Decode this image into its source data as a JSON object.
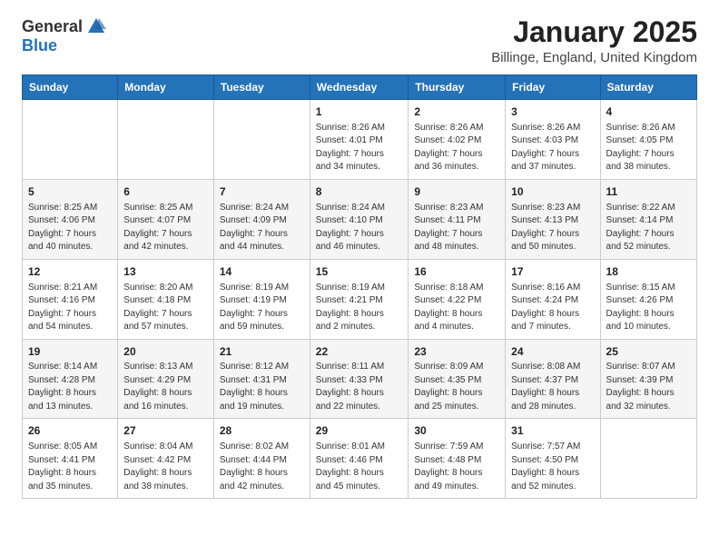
{
  "header": {
    "logo_general": "General",
    "logo_blue": "Blue",
    "month_title": "January 2025",
    "location": "Billinge, England, United Kingdom"
  },
  "weekdays": [
    "Sunday",
    "Monday",
    "Tuesday",
    "Wednesday",
    "Thursday",
    "Friday",
    "Saturday"
  ],
  "weeks": [
    [
      {
        "day": "",
        "info": ""
      },
      {
        "day": "",
        "info": ""
      },
      {
        "day": "",
        "info": ""
      },
      {
        "day": "1",
        "info": "Sunrise: 8:26 AM\nSunset: 4:01 PM\nDaylight: 7 hours\nand 34 minutes."
      },
      {
        "day": "2",
        "info": "Sunrise: 8:26 AM\nSunset: 4:02 PM\nDaylight: 7 hours\nand 36 minutes."
      },
      {
        "day": "3",
        "info": "Sunrise: 8:26 AM\nSunset: 4:03 PM\nDaylight: 7 hours\nand 37 minutes."
      },
      {
        "day": "4",
        "info": "Sunrise: 8:26 AM\nSunset: 4:05 PM\nDaylight: 7 hours\nand 38 minutes."
      }
    ],
    [
      {
        "day": "5",
        "info": "Sunrise: 8:25 AM\nSunset: 4:06 PM\nDaylight: 7 hours\nand 40 minutes."
      },
      {
        "day": "6",
        "info": "Sunrise: 8:25 AM\nSunset: 4:07 PM\nDaylight: 7 hours\nand 42 minutes."
      },
      {
        "day": "7",
        "info": "Sunrise: 8:24 AM\nSunset: 4:09 PM\nDaylight: 7 hours\nand 44 minutes."
      },
      {
        "day": "8",
        "info": "Sunrise: 8:24 AM\nSunset: 4:10 PM\nDaylight: 7 hours\nand 46 minutes."
      },
      {
        "day": "9",
        "info": "Sunrise: 8:23 AM\nSunset: 4:11 PM\nDaylight: 7 hours\nand 48 minutes."
      },
      {
        "day": "10",
        "info": "Sunrise: 8:23 AM\nSunset: 4:13 PM\nDaylight: 7 hours\nand 50 minutes."
      },
      {
        "day": "11",
        "info": "Sunrise: 8:22 AM\nSunset: 4:14 PM\nDaylight: 7 hours\nand 52 minutes."
      }
    ],
    [
      {
        "day": "12",
        "info": "Sunrise: 8:21 AM\nSunset: 4:16 PM\nDaylight: 7 hours\nand 54 minutes."
      },
      {
        "day": "13",
        "info": "Sunrise: 8:20 AM\nSunset: 4:18 PM\nDaylight: 7 hours\nand 57 minutes."
      },
      {
        "day": "14",
        "info": "Sunrise: 8:19 AM\nSunset: 4:19 PM\nDaylight: 7 hours\nand 59 minutes."
      },
      {
        "day": "15",
        "info": "Sunrise: 8:19 AM\nSunset: 4:21 PM\nDaylight: 8 hours\nand 2 minutes."
      },
      {
        "day": "16",
        "info": "Sunrise: 8:18 AM\nSunset: 4:22 PM\nDaylight: 8 hours\nand 4 minutes."
      },
      {
        "day": "17",
        "info": "Sunrise: 8:16 AM\nSunset: 4:24 PM\nDaylight: 8 hours\nand 7 minutes."
      },
      {
        "day": "18",
        "info": "Sunrise: 8:15 AM\nSunset: 4:26 PM\nDaylight: 8 hours\nand 10 minutes."
      }
    ],
    [
      {
        "day": "19",
        "info": "Sunrise: 8:14 AM\nSunset: 4:28 PM\nDaylight: 8 hours\nand 13 minutes."
      },
      {
        "day": "20",
        "info": "Sunrise: 8:13 AM\nSunset: 4:29 PM\nDaylight: 8 hours\nand 16 minutes."
      },
      {
        "day": "21",
        "info": "Sunrise: 8:12 AM\nSunset: 4:31 PM\nDaylight: 8 hours\nand 19 minutes."
      },
      {
        "day": "22",
        "info": "Sunrise: 8:11 AM\nSunset: 4:33 PM\nDaylight: 8 hours\nand 22 minutes."
      },
      {
        "day": "23",
        "info": "Sunrise: 8:09 AM\nSunset: 4:35 PM\nDaylight: 8 hours\nand 25 minutes."
      },
      {
        "day": "24",
        "info": "Sunrise: 8:08 AM\nSunset: 4:37 PM\nDaylight: 8 hours\nand 28 minutes."
      },
      {
        "day": "25",
        "info": "Sunrise: 8:07 AM\nSunset: 4:39 PM\nDaylight: 8 hours\nand 32 minutes."
      }
    ],
    [
      {
        "day": "26",
        "info": "Sunrise: 8:05 AM\nSunset: 4:41 PM\nDaylight: 8 hours\nand 35 minutes."
      },
      {
        "day": "27",
        "info": "Sunrise: 8:04 AM\nSunset: 4:42 PM\nDaylight: 8 hours\nand 38 minutes."
      },
      {
        "day": "28",
        "info": "Sunrise: 8:02 AM\nSunset: 4:44 PM\nDaylight: 8 hours\nand 42 minutes."
      },
      {
        "day": "29",
        "info": "Sunrise: 8:01 AM\nSunset: 4:46 PM\nDaylight: 8 hours\nand 45 minutes."
      },
      {
        "day": "30",
        "info": "Sunrise: 7:59 AM\nSunset: 4:48 PM\nDaylight: 8 hours\nand 49 minutes."
      },
      {
        "day": "31",
        "info": "Sunrise: 7:57 AM\nSunset: 4:50 PM\nDaylight: 8 hours\nand 52 minutes."
      },
      {
        "day": "",
        "info": ""
      }
    ]
  ]
}
